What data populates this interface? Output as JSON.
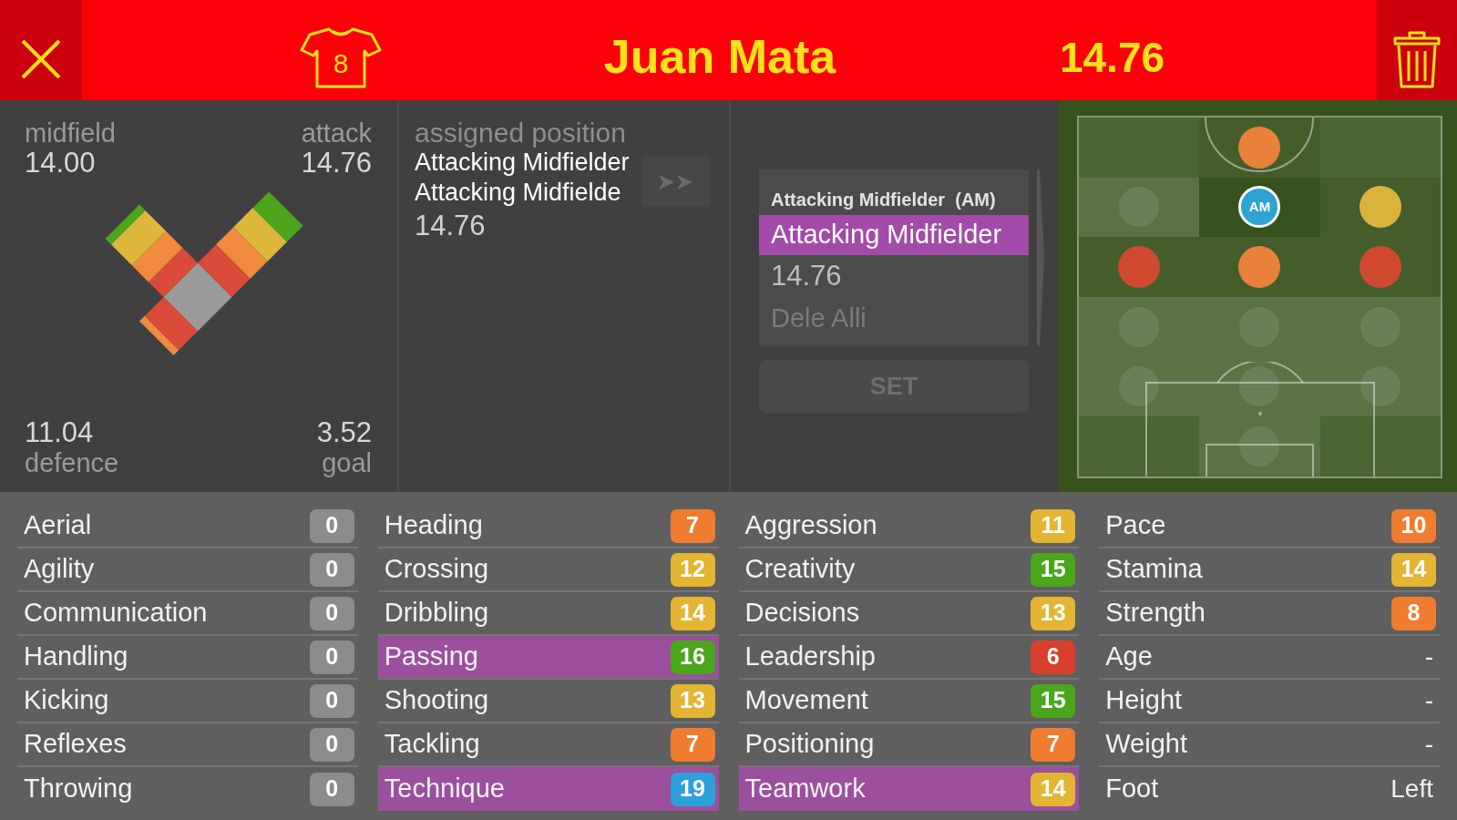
{
  "header": {
    "shirt_number": "8",
    "player_name": "Juan Mata",
    "rating": "14.76"
  },
  "position_ratings": {
    "zones": [
      {
        "label": "midfield",
        "value": "14.00"
      },
      {
        "label": "attack",
        "value": "14.76"
      },
      {
        "label": "defence",
        "value": "11.04"
      },
      {
        "label": "goal",
        "value": "3.52"
      }
    ]
  },
  "assigned_position": {
    "label": "assigned position",
    "lines": [
      "Attacking Midfielder",
      "Attacking Midfielde"
    ],
    "rating": "14.76"
  },
  "position_card": {
    "heading": "Attacking Midfielder  (AM)",
    "rows": [
      {
        "kind": "position",
        "text": "Attacking Midfielder",
        "selected": true
      },
      {
        "kind": "rating",
        "text": "14.76",
        "selected": false
      },
      {
        "kind": "player",
        "text": "Dele Alli",
        "selected": false
      }
    ],
    "button": {
      "label": "SET",
      "disabled": true
    }
  },
  "pitch": {
    "rows": [
      {
        "cells": [
          {
            "kind": "none",
            "selected": false
          },
          {
            "kind": "rated",
            "color": "#e8823a",
            "selected": false
          },
          {
            "kind": "none",
            "selected": false
          }
        ]
      },
      {
        "cells": [
          {
            "kind": "empty",
            "selected": false
          },
          {
            "kind": "rated",
            "color": "#2fa3d3",
            "label": "AM",
            "selected": true
          },
          {
            "kind": "rated",
            "color": "#dcb33a",
            "selected": false
          }
        ]
      },
      {
        "cells": [
          {
            "kind": "rated",
            "color": "#d04a30",
            "selected": false
          },
          {
            "kind": "rated",
            "color": "#e8823a",
            "selected": false
          },
          {
            "kind": "rated",
            "color": "#d04a30",
            "selected": false
          }
        ]
      },
      {
        "cells": [
          {
            "kind": "empty",
            "selected": false
          },
          {
            "kind": "empty",
            "selected": false
          },
          {
            "kind": "empty",
            "selected": false
          }
        ]
      },
      {
        "cells": [
          {
            "kind": "empty",
            "selected": false
          },
          {
            "kind": "empty",
            "selected": false
          },
          {
            "kind": "empty",
            "selected": false
          }
        ]
      },
      {
        "cells": [
          {
            "kind": "none",
            "selected": false
          },
          {
            "kind": "empty",
            "selected": false
          },
          {
            "kind": "none",
            "selected": false
          }
        ]
      }
    ]
  },
  "attributes": {
    "columns": [
      {
        "items": [
          {
            "kind": "rating",
            "name": "Aerial",
            "value": "0",
            "color": "#8c8c8c",
            "highlighted": false
          },
          {
            "kind": "rating",
            "name": "Agility",
            "value": "0",
            "color": "#8c8c8c",
            "highlighted": false
          },
          {
            "kind": "rating",
            "name": "Communication",
            "value": "0",
            "color": "#8c8c8c",
            "highlighted": false
          },
          {
            "kind": "rating",
            "name": "Handling",
            "value": "0",
            "color": "#8c8c8c",
            "highlighted": false
          },
          {
            "kind": "rating",
            "name": "Kicking",
            "value": "0",
            "color": "#8c8c8c",
            "highlighted": false
          },
          {
            "kind": "rating",
            "name": "Reflexes",
            "value": "0",
            "color": "#8c8c8c",
            "highlighted": false
          },
          {
            "kind": "rating",
            "name": "Throwing",
            "value": "0",
            "color": "#8c8c8c",
            "highlighted": false
          }
        ]
      },
      {
        "items": [
          {
            "kind": "rating",
            "name": "Heading",
            "value": "7",
            "color": "#f07c30",
            "highlighted": false
          },
          {
            "kind": "rating",
            "name": "Crossing",
            "value": "12",
            "color": "#e3b532",
            "highlighted": false
          },
          {
            "kind": "rating",
            "name": "Dribbling",
            "value": "14",
            "color": "#e3b532",
            "highlighted": false
          },
          {
            "kind": "rating",
            "name": "Passing",
            "value": "16",
            "color": "#4aa61b",
            "highlighted": true
          },
          {
            "kind": "rating",
            "name": "Shooting",
            "value": "13",
            "color": "#e3b532",
            "highlighted": false
          },
          {
            "kind": "rating",
            "name": "Tackling",
            "value": "7",
            "color": "#f07c30",
            "highlighted": false
          },
          {
            "kind": "rating",
            "name": "Technique",
            "value": "19",
            "color": "#2ca0d8",
            "highlighted": true
          }
        ]
      },
      {
        "items": [
          {
            "kind": "rating",
            "name": "Aggression",
            "value": "11",
            "color": "#e3b532",
            "highlighted": false
          },
          {
            "kind": "rating",
            "name": "Creativity",
            "value": "15",
            "color": "#4aa61b",
            "highlighted": false
          },
          {
            "kind": "rating",
            "name": "Decisions",
            "value": "13",
            "color": "#e3b532",
            "highlighted": false
          },
          {
            "kind": "rating",
            "name": "Leadership",
            "value": "6",
            "color": "#da3f2d",
            "highlighted": false
          },
          {
            "kind": "rating",
            "name": "Movement",
            "value": "15",
            "color": "#4aa61b",
            "highlighted": false
          },
          {
            "kind": "rating",
            "name": "Positioning",
            "value": "7",
            "color": "#f07c30",
            "highlighted": false
          },
          {
            "kind": "rating",
            "name": "Teamwork",
            "value": "14",
            "color": "#e3b532",
            "highlighted": true
          }
        ]
      },
      {
        "items": [
          {
            "kind": "rating",
            "name": "Pace",
            "value": "10",
            "color": "#f07c30",
            "highlighted": false
          },
          {
            "kind": "rating",
            "name": "Stamina",
            "value": "14",
            "color": "#e3b532",
            "highlighted": false
          },
          {
            "kind": "rating",
            "name": "Strength",
            "value": "8",
            "color": "#f07c30",
            "highlighted": false
          },
          {
            "kind": "info",
            "name": "Age",
            "value": "-",
            "highlighted": false
          },
          {
            "kind": "info",
            "name": "Height",
            "value": "-",
            "highlighted": false
          },
          {
            "kind": "info",
            "name": "Weight",
            "value": "-",
            "highlighted": false
          },
          {
            "kind": "info",
            "name": "Foot",
            "value": "Left",
            "highlighted": false
          }
        ]
      }
    ]
  }
}
